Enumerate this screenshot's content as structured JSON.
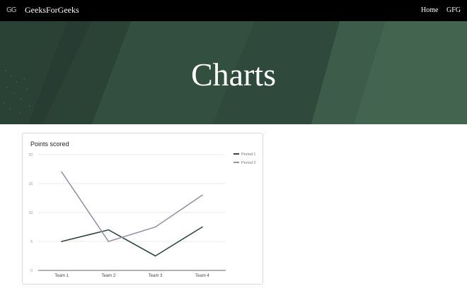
{
  "navbar": {
    "logo": "GG",
    "brand": "GeeksForGeeks",
    "links": [
      "Home",
      "GFG"
    ]
  },
  "hero": {
    "title": "Charts",
    "colors": {
      "base": "#2f4a3c",
      "light": "#3f5f4c",
      "dark": "#25392f"
    }
  },
  "chart_data": {
    "type": "line",
    "title": "Points scored",
    "categories": [
      "Team 1",
      "Team 2",
      "Team 3",
      "Team 4"
    ],
    "series": [
      {
        "name": "Period 1",
        "values": [
          5,
          7,
          2.5,
          7.5
        ],
        "color": "#2f4a3c"
      },
      {
        "name": "Period 2",
        "values": [
          17,
          5,
          7.5,
          13
        ],
        "color": "#9a92a8"
      }
    ],
    "yticks": [
      "0",
      "5",
      "10",
      "15",
      "20"
    ],
    "ylim": [
      0,
      20
    ],
    "grid": true,
    "legend": "right",
    "xlabel": "",
    "ylabel": ""
  }
}
